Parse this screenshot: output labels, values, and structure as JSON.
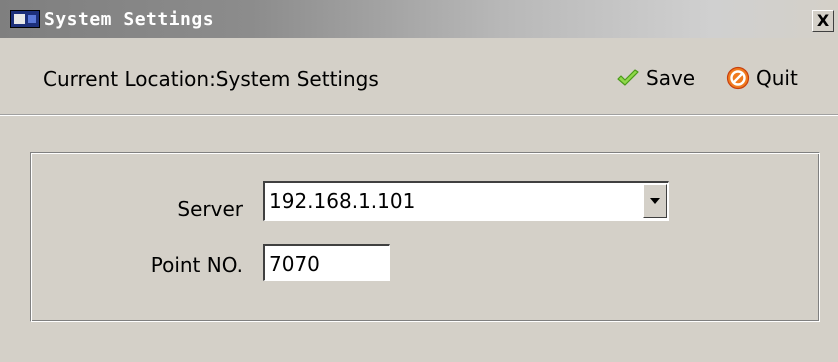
{
  "window": {
    "title": "System Settings",
    "close_label": "X",
    "icon": "app-window-icon"
  },
  "toolbar": {
    "location_text": "Current Location:System Settings",
    "save_label": "Save",
    "save_icon": "checkmark-icon",
    "quit_label": "Quit",
    "quit_icon": "no-entry-icon"
  },
  "form": {
    "server_label": "Server",
    "server_value": "192.168.1.101",
    "point_label": "Point NO.",
    "point_value": "7070"
  },
  "colors": {
    "background": "#d4d0c8",
    "save_icon": "#6bbf2c",
    "quit_icon": "#e0461a"
  }
}
